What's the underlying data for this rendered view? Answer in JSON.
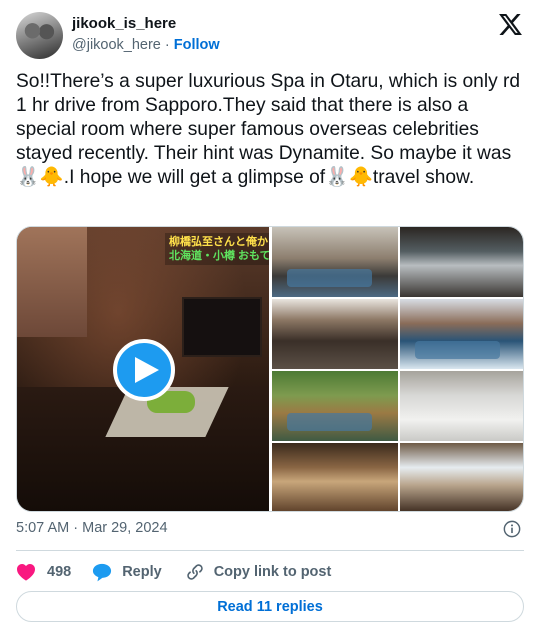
{
  "author": {
    "display_name": "jikook_is_here",
    "handle": "@jikook_here",
    "separator": "·",
    "follow_label": "Follow"
  },
  "tweet": {
    "text": "So!!There’s a super luxurious Spa in Otaru, which is only rd 1 hr drive from Sapporo.They said that there is also a special room where super famous overseas celebrities stayed recently. Their hint was Dynamite. So maybe it was 🐰🐥.I hope we will get a glimpse of🐰🐥travel show."
  },
  "media": {
    "video_caption_line1": "柳橋弘至さんと俺か",
    "video_caption_line2": "北海道・小樽 おもて"
  },
  "meta": {
    "time": "5:07 AM",
    "separator": "·",
    "date": "Mar 29, 2024"
  },
  "actions": {
    "like_count": "498",
    "reply_label": "Reply",
    "copy_label": "Copy link to post"
  },
  "footer": {
    "read_replies_label": "Read 11 replies"
  },
  "colors": {
    "like": "#f91880",
    "accent": "#1d9bf0",
    "link": "#006fd6",
    "secondary_text": "#536471",
    "border": "#cfd9de"
  },
  "icons": {
    "logo": "x-logo-icon",
    "play": "play-icon",
    "info": "info-icon",
    "like": "heart-icon",
    "reply": "speech-bubble-icon",
    "copy": "link-icon"
  }
}
